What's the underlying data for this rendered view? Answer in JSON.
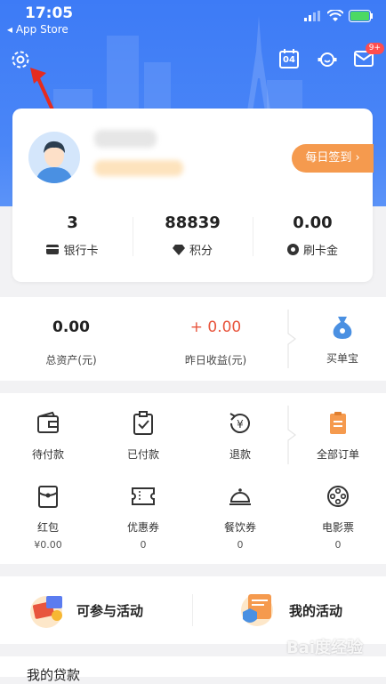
{
  "status_bar": {
    "time": "17:05",
    "back_app": "App Store"
  },
  "header": {
    "calendar_day": "04",
    "message_badge": "9+"
  },
  "profile": {
    "checkin_label": "每日签到",
    "stats": [
      {
        "value": "3",
        "label": "银行卡",
        "icon": "bank-card-icon"
      },
      {
        "value": "88839",
        "label": "积分",
        "icon": "diamond-icon"
      },
      {
        "value": "0.00",
        "label": "刷卡金",
        "icon": "coin-icon"
      }
    ]
  },
  "assets": {
    "total_value": "0.00",
    "total_label": "总资产(元)",
    "yesterday_value": "+ 0.00",
    "yesterday_label": "昨日收益(元)",
    "maidanbao_label": "买单宝"
  },
  "orders": {
    "items": [
      {
        "label": "待付款",
        "icon": "wallet-icon"
      },
      {
        "label": "已付款",
        "icon": "clipboard-check-icon"
      },
      {
        "label": "退款",
        "icon": "refund-icon"
      },
      {
        "label": "全部订单",
        "icon": "orders-icon"
      }
    ],
    "benefits": [
      {
        "label": "红包",
        "value": "¥0.00",
        "icon": "red-packet-icon"
      },
      {
        "label": "优惠券",
        "value": "0",
        "icon": "coupon-icon"
      },
      {
        "label": "餐饮券",
        "value": "0",
        "icon": "dining-icon"
      },
      {
        "label": "电影票",
        "value": "0",
        "icon": "film-icon"
      }
    ]
  },
  "activities": {
    "join_label": "可参与活动",
    "mine_label": "我的活动"
  },
  "footer": {
    "loan_label": "我的贷款",
    "watermark": "Bai度经验"
  },
  "colors": {
    "accent_blue": "#3d7bf6",
    "orange": "#f59a4e",
    "red": "#e8553d"
  }
}
